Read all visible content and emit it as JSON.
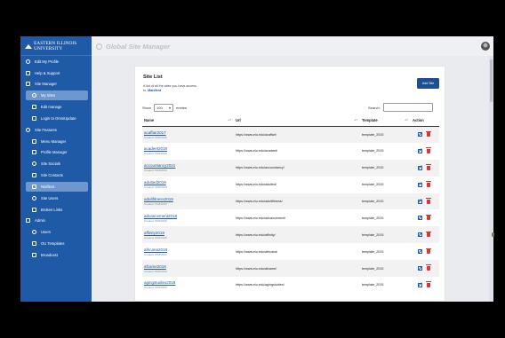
{
  "app": {
    "logo_text": "EASTERN ILLINOIS UNIVERSITY",
    "header_title": "Global Site Manager"
  },
  "sidebar": {
    "items": [
      {
        "label": "Edit My Profile",
        "icon": "user-icon",
        "sub": false
      },
      {
        "label": "Help & Support",
        "icon": "help-icon",
        "sub": false
      },
      {
        "label": "Site Manager",
        "icon": "bars-icon",
        "sub": false
      },
      {
        "label": "My Sites",
        "icon": "grid-icon",
        "sub": true,
        "active": true
      },
      {
        "label": "Edit manage",
        "icon": "pencil-icon",
        "sub": true
      },
      {
        "label": "Login to OmniUpdate",
        "icon": "login-icon",
        "sub": true
      },
      {
        "label": "Site Features",
        "icon": "gear-icon",
        "sub": false
      },
      {
        "label": "Menu Manager",
        "icon": "menu-icon",
        "sub": true
      },
      {
        "label": "Profile Manager",
        "icon": "profile-icon",
        "sub": true
      },
      {
        "label": "Site Socials",
        "icon": "share-icon",
        "sub": true
      },
      {
        "label": "Site Contacts",
        "icon": "contacts-icon",
        "sub": true
      },
      {
        "label": "Notifiers",
        "icon": "bell-icon",
        "sub": true,
        "active": true
      },
      {
        "label": "Site Users",
        "icon": "users-icon",
        "sub": true
      },
      {
        "label": "Broken Links",
        "icon": "link-icon",
        "sub": true
      },
      {
        "label": "Admin",
        "icon": "admin-icon",
        "sub": false
      },
      {
        "label": "Users",
        "icon": "users-icon",
        "sub": true
      },
      {
        "label": "OU Templates",
        "icon": "file-icon",
        "sub": true
      },
      {
        "label": "Broadcast",
        "icon": "broadcast-icon",
        "sub": true
      }
    ]
  },
  "main": {
    "title": "Site List",
    "description": "A list of all the sites you have access to.",
    "description_link": "Manifest",
    "add_button": "Add Site",
    "show_label": "Show",
    "show_value": "100",
    "entries_label": "entries",
    "search_label": "Search:",
    "columns": [
      "Name",
      "Url",
      "Template",
      "Action"
    ],
    "rows": [
      {
        "name": "acaffair2017",
        "created": "Created: 8/18/2020",
        "url": "https://www.eiu.edu/acaffair/",
        "template": "template_2015"
      },
      {
        "name": "acadeet2018",
        "created": "Created: 8/18/2020",
        "url": "https://www.eiu.edu/acadeet/",
        "template": "template_2015"
      },
      {
        "name": "accountancy2021",
        "created": "Created: 8/18/2020",
        "url": "https://www.eiu.edu/accountancy/",
        "template": "template_2015"
      },
      {
        "name": "adulted2019",
        "created": "Created: 8/18/2020",
        "url": "https://www.eiu.edu/adulted/",
        "template": "template_2015"
      },
      {
        "name": "adultfitness2019",
        "created": "Created: 8/18/2020",
        "url": "https://www.eiu.edu/adultfitness/",
        "template": "template_2015"
      },
      {
        "name": "advancement2018",
        "created": "Created: 8/18/2020",
        "url": "https://www.eiu.edu/advancement/",
        "template": "template_2015"
      },
      {
        "name": "affinity2019",
        "created": "Created: 8/18/2020",
        "url": "https://www.eiu.edu/affinity/",
        "template": "template_2015"
      },
      {
        "name": "africana2018",
        "created": "Created: 8/18/2020",
        "url": "https://www.eiu.edu/africana/",
        "template": "template_2015"
      },
      {
        "name": "afcame2018",
        "created": "Created: 8/18/2020",
        "url": "https://www.eiu.edu/afcame/",
        "template": "template_2015"
      },
      {
        "name": "agingstudies2018",
        "created": "Created: 8/18/2020",
        "url": "https://www.eiu.edu/agingstudies/",
        "template": "template_2015"
      }
    ]
  },
  "colors": {
    "sidebar": "#1f5aa6",
    "accent": "#1f4f93",
    "link": "#1f5aa6",
    "delete": "#d9363e"
  }
}
